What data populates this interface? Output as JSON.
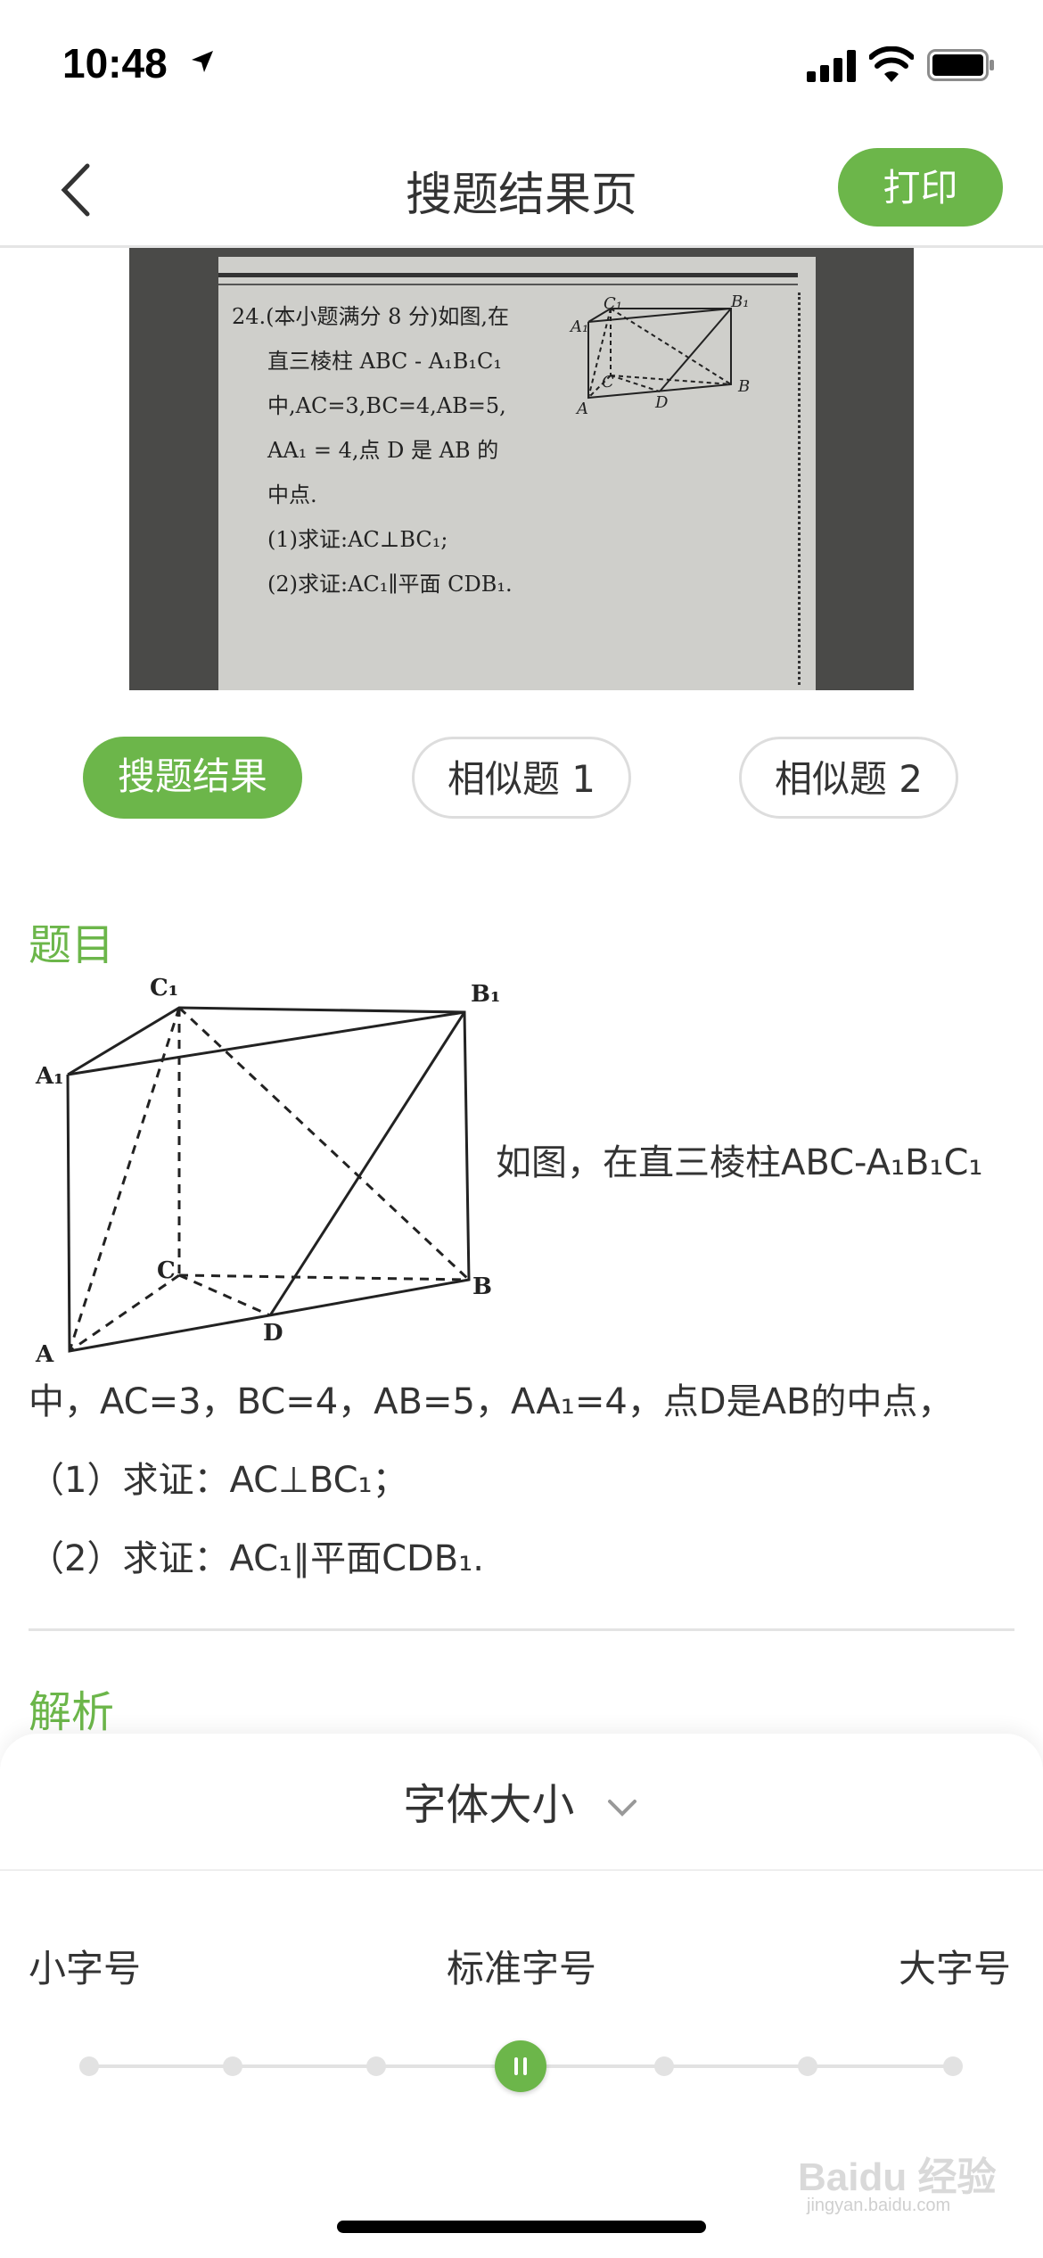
{
  "status": {
    "time": "10:48"
  },
  "nav": {
    "title": "搜题结果页",
    "print_label": "打印"
  },
  "tabs": [
    {
      "label": "搜题结果",
      "active": true
    },
    {
      "label": "相似题 1",
      "active": false
    },
    {
      "label": "相似题 2",
      "active": false
    }
  ],
  "photo": {
    "lines": [
      "24.(本小题满分 8 分)如图,在",
      "直三棱柱 ABC - A₁B₁C₁",
      "中,AC=3,BC=4,AB=5,",
      "AA₁ = 4,点 D 是 AB 的",
      "中点.",
      "(1)求证:AC⊥BC₁;",
      "(2)求证:AC₁∥平面 CDB₁."
    ],
    "figure_labels": {
      "c1": "C₁",
      "b1": "B₁",
      "a1": "A₁",
      "c": "C",
      "a": "A",
      "d": "D",
      "b": "B"
    }
  },
  "question": {
    "section_title": "题目",
    "intro": "如图，在直三棱柱ABC-A₁B₁C₁",
    "line1": "中，AC=3，BC=4，AB=5，AA₁=4，点D是AB的中点，",
    "line2": "（1）求证：AC⊥BC₁；",
    "line3": "（2）求证：AC₁∥平面CDB₁.",
    "figure_labels": {
      "c1": "C₁",
      "b1": "B₁",
      "a1": "A₁",
      "c": "C",
      "a": "A",
      "d": "D",
      "b": "B"
    }
  },
  "analysis": {
    "section_title": "解析"
  },
  "font_sheet": {
    "title": "字体大小",
    "small": "小字号",
    "standard": "标准字号",
    "large": "大字号",
    "level_fraction": 0.5
  },
  "watermark": {
    "brand": "Baidu 经验",
    "url": "jingyan.baidu.com"
  },
  "colors": {
    "accent": "#6cb64a",
    "text": "#333333"
  }
}
